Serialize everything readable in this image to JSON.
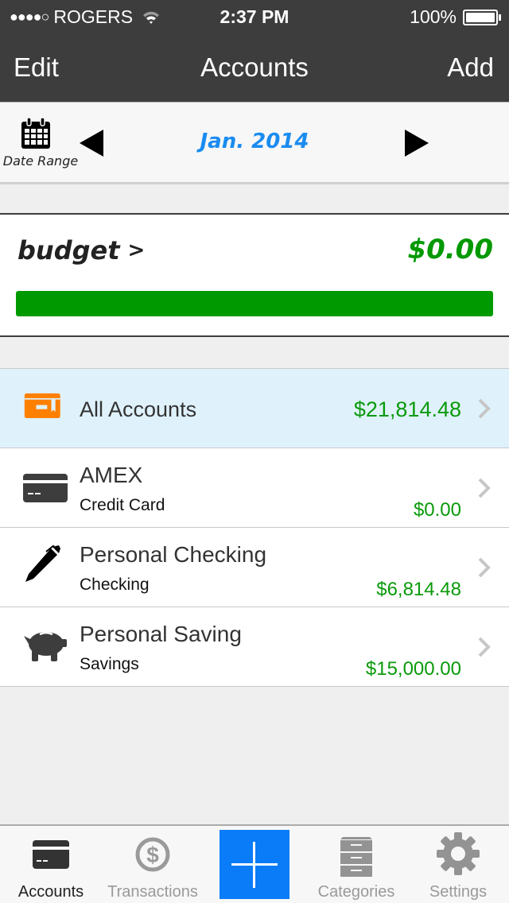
{
  "status_bar": {
    "signal_dots": "●●●●○",
    "carrier": "ROGERS",
    "time": "2:37 PM",
    "battery": "100%"
  },
  "navbar": {
    "left_button": "Edit",
    "title": "Accounts",
    "right_button": "Add"
  },
  "date_bar": {
    "date_range_label": "Date Range",
    "current_period": "Jan. 2014",
    "icons": {
      "calendar": "calendar-icon",
      "prev": "triangle-left",
      "next": "triangle-right"
    }
  },
  "budget": {
    "title": "budget",
    "chevron": ">",
    "amount": "$0.00",
    "progress_percent": 100,
    "bar_color": "#009a00"
  },
  "accounts": {
    "all": {
      "name": "All Accounts",
      "amount": "$21,814.48",
      "icon": "wallet-icon",
      "icon_color": "#ff8000"
    },
    "items": [
      {
        "name": "AMEX",
        "type": "Credit Card",
        "amount": "$0.00",
        "icon": "credit-card-icon"
      },
      {
        "name": "Personal Checking",
        "type": "Checking",
        "amount": "$6,814.48",
        "icon": "pen-icon"
      },
      {
        "name": "Personal Saving",
        "type": "Savings",
        "amount": "$15,000.00",
        "icon": "piggy-bank-icon"
      }
    ]
  },
  "tabbar": {
    "tabs": [
      {
        "label": "Accounts",
        "icon": "credit-card-icon",
        "active": true
      },
      {
        "label": "Transactions",
        "icon": "dollar-circle-icon",
        "active": false
      },
      {
        "label": "",
        "icon": "plus-icon",
        "active": false
      },
      {
        "label": "Categories",
        "icon": "file-cabinet-icon",
        "active": false
      },
      {
        "label": "Settings",
        "icon": "gear-icon",
        "active": false
      }
    ]
  },
  "colors": {
    "nav_bg": "#3d3d3d",
    "accent_blue": "#0a7cf7",
    "date_blue": "#1a8cf0",
    "money_green": "#0a9a0a",
    "highlight_row": "#dff2fc"
  }
}
